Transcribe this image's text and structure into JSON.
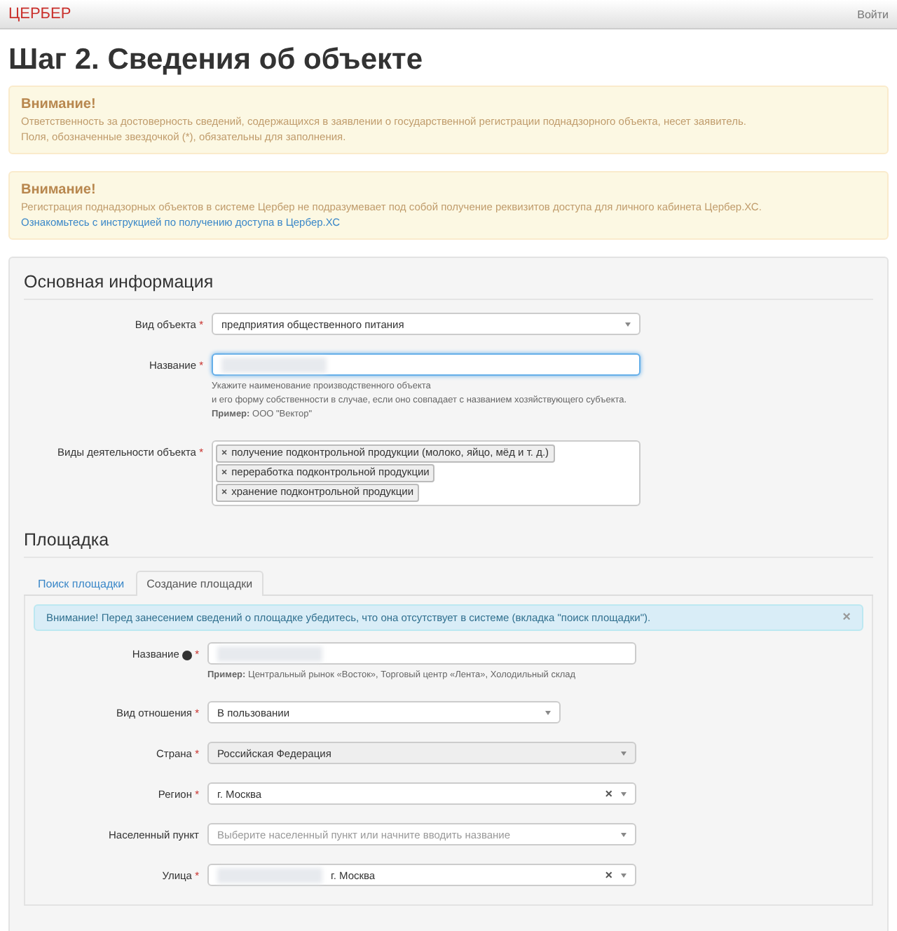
{
  "navbar": {
    "brand": "ЦЕРБЕР",
    "login": "Войти"
  },
  "title": "Шаг 2. Сведения об объекте",
  "required_mark": "*",
  "tag_remove": "×",
  "alerts": [
    {
      "heading": "Внимание!",
      "lines": [
        "Ответственность за достоверность сведений, содержащихся в заявлении о государственной регистрации поднадзорного объекта, несет заявитель.",
        "Поля, обозначенные звездочкой (*), обязательны для заполнения."
      ]
    },
    {
      "heading": "Внимание!",
      "lines": [
        "Регистрация поднадзорных объектов в системе Цербер не подразумевает под собой получение реквизитов доступа для личного кабинета Цербер.ХС."
      ],
      "link": "Ознакомьтесь с инструкцией по получению доступа в Цербер.ХС"
    }
  ],
  "main_section": {
    "heading": "Основная информация",
    "fields": [
      {
        "kind": "select",
        "label": "Вид объекта",
        "required": true,
        "value": "предприятия общественного питания"
      },
      {
        "kind": "input",
        "label": "Название",
        "required": true,
        "redacted": true,
        "focused": true,
        "hint": [
          "Укажите наименование производственного объекта",
          "и его форму собственности в случае, если оно совпадает с названием хозяйствующего субъекта.",
          "**Пример:** ООО \"Вектор\""
        ]
      },
      {
        "kind": "tags",
        "label": "Виды деятельности объекта",
        "required": true,
        "tags": [
          "получение подконтрольной продукции (молоко, яйцо, мёд и т. д.)",
          "переработка подконтрольной продукции",
          "хранение подконтрольной продукции"
        ]
      }
    ]
  },
  "site_section": {
    "heading": "Площадка",
    "tabs": [
      {
        "label": "Поиск площадки",
        "selected": false
      },
      {
        "label": "Создание площадки",
        "selected": true
      }
    ],
    "info": {
      "text": "Внимание! Перед занесением сведений о площадке убедитесь, что она отсутствует в системе (вкладка \"поиск площадки\").",
      "close": "×"
    },
    "fields": [
      {
        "kind": "input",
        "label": "Название",
        "help_icon": true,
        "required": true,
        "redacted": true,
        "focused": false,
        "hint": [
          "**Пример:** Центральный рынок «Восток», Торговый центр «Лента», Холодильный склад"
        ]
      },
      {
        "kind": "select",
        "label": "Вид отношения",
        "required": true,
        "value": "В пользовании",
        "short": true
      },
      {
        "kind": "select",
        "label": "Страна",
        "required": true,
        "value": "Российская Федерация",
        "disabled": true
      },
      {
        "kind": "select",
        "label": "Регион",
        "required": true,
        "value": "г. Москва",
        "clear": "×"
      },
      {
        "kind": "select",
        "label": "Населенный пункт",
        "required": false,
        "placeholder": "Выберите населенный пункт или начните вводить название"
      },
      {
        "kind": "select",
        "label": "Улица",
        "required": true,
        "redacted": true,
        "value": "г. Москва",
        "clear": "×"
      }
    ]
  }
}
